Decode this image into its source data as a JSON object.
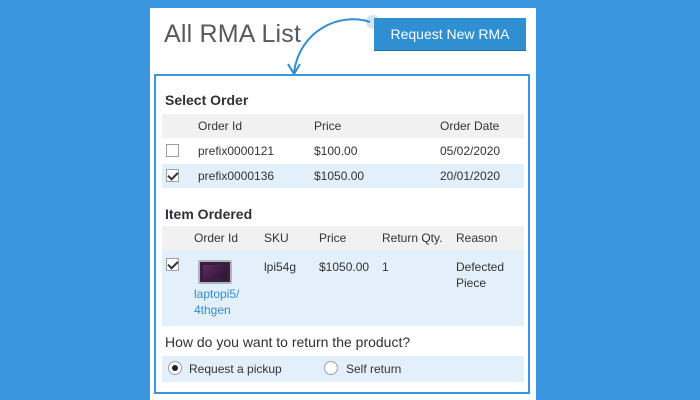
{
  "page": {
    "title": "All RMA List",
    "request_button": "Request New RMA"
  },
  "select_order": {
    "heading": "Select Order",
    "columns": [
      "Order Id",
      "Price",
      "Order Date"
    ],
    "rows": [
      {
        "order_id": "prefix0000121",
        "price": "$100.00",
        "date": "05/02/2020",
        "checked": false
      },
      {
        "order_id": "prefix0000136",
        "price": "$1050.00",
        "date": "20/01/2020",
        "checked": true
      }
    ]
  },
  "item_ordered": {
    "heading": "Item Ordered",
    "columns": [
      "Order Id",
      "SKU",
      "Price",
      "Return Qty.",
      "Reason"
    ],
    "item": {
      "checked": true,
      "name_line1": "laptopi5/",
      "name_line2": "4thgen",
      "sku": "lpi54g",
      "price": "$1050.00",
      "qty": "1",
      "reason_line1": "Defected",
      "reason_line2": "Piece"
    }
  },
  "return_method": {
    "question": "How do you want to return the product?",
    "options": [
      "Request a pickup",
      "Self return"
    ],
    "selected": "Request a pickup"
  },
  "colors": {
    "background": "#3a96de",
    "accent": "#2f8fd0",
    "selected_row": "#e3effa"
  }
}
